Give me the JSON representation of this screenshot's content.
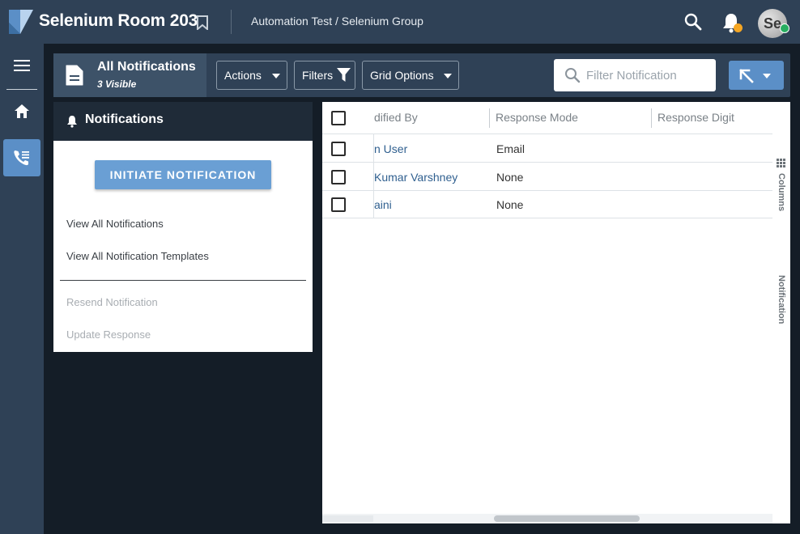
{
  "header": {
    "app_title": "Selenium Room 203",
    "breadcrumb": "Automation Test / Selenium Group",
    "avatar_initials": "Se",
    "colors": {
      "bar": "#2f4156",
      "notification_dot": "#f5a623",
      "online_dot": "#27ae60"
    }
  },
  "rail": {
    "items": [
      {
        "icon": "menu-icon"
      },
      {
        "icon": "home-icon"
      },
      {
        "icon": "phone-list-icon",
        "active": true
      }
    ]
  },
  "toolbar": {
    "page_title": "All Notifications",
    "visible_count": "3 Visible",
    "actions_label": "Actions",
    "filters_label": "Filters",
    "grid_options_label": "Grid Options",
    "search_placeholder": "Filter Notification"
  },
  "notifications_panel": {
    "title": "Notifications",
    "initiate_label": "INITIATE NOTIFICATION",
    "links": [
      "View All Notifications",
      "View All Notification Templates"
    ],
    "disabled_links": [
      "Resend Notification",
      "Update Response"
    ]
  },
  "grid": {
    "columns": [
      "dified By",
      "Response Mode",
      "Response Digit"
    ],
    "rows": [
      {
        "modified_by": "n User",
        "response_mode": "Email",
        "response_digit": ""
      },
      {
        "modified_by": "Kumar Varshney",
        "response_mode": "None",
        "response_digit": ""
      },
      {
        "modified_by": "aini",
        "response_mode": "None",
        "response_digit": ""
      }
    ],
    "side_tabs": [
      "Columns",
      "Notification"
    ]
  }
}
